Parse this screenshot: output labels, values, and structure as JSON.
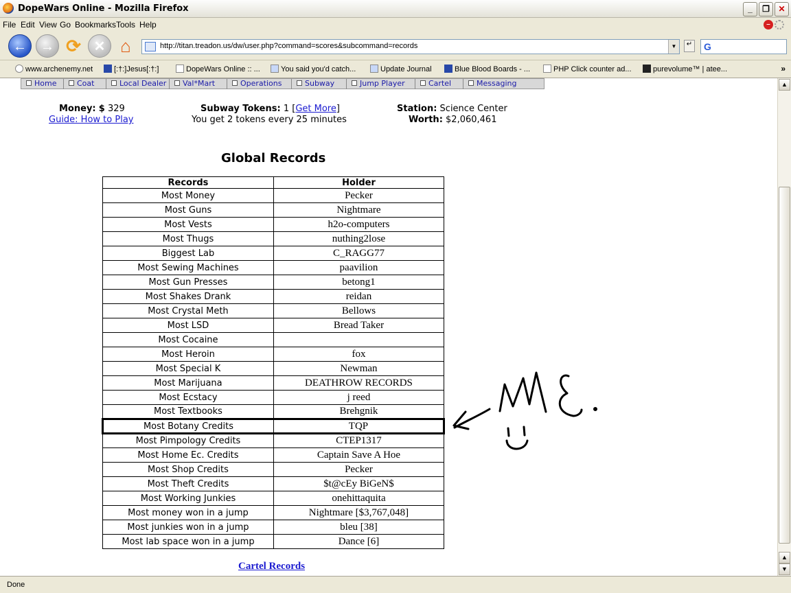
{
  "window": {
    "title": "DopeWars Online - Mozilla Firefox"
  },
  "menu": [
    "File",
    "Edit",
    "View",
    "Go",
    "Bookmarks",
    "Tools",
    "Help"
  ],
  "address": {
    "url": "http://titan.treadon.us/dw/user.php?command=scores&subcommand=records"
  },
  "search": {
    "engine_glyph": "G"
  },
  "bookmarks": [
    "www.archenemy.net",
    "[:†:]Jesus[:†:]",
    "DopeWars Online :: ...",
    "You said you'd catch...",
    "Update Journal",
    "Blue Blood Boards - ...",
    "PHP Click counter ad...",
    "purevolume™ | atee..."
  ],
  "bookmarks_more": "»",
  "game_nav": [
    "Home",
    "Coat",
    "Local Dealer",
    "Val*Mart",
    "Operations",
    "Subway",
    "Jump Player",
    "Cartel",
    "Messaging"
  ],
  "summary": {
    "money_label": "Money:",
    "money_currency": "$",
    "money_value": "329",
    "guide_link": "Guide: How to Play",
    "tokens_label": "Subway Tokens:",
    "tokens_value": "1",
    "get_more": "Get More",
    "tokens_note": "You get 2 tokens every 25 minutes",
    "station_label": "Station:",
    "station_value": "Science Center",
    "worth_label": "Worth:",
    "worth_value": "$2,060,461"
  },
  "records": {
    "title": "Global Records",
    "headers": [
      "Records",
      "Holder"
    ],
    "rows": [
      [
        "Most Money",
        "Pecker"
      ],
      [
        "Most Guns",
        "Nightmare"
      ],
      [
        "Most Vests",
        "h2o-computers"
      ],
      [
        "Most Thugs",
        "nuthing2lose"
      ],
      [
        "Biggest Lab",
        "C_RAGG77"
      ],
      [
        "Most Sewing Machines",
        "paavilion"
      ],
      [
        "Most Gun Presses",
        "betong1"
      ],
      [
        "Most Shakes Drank",
        "reidan"
      ],
      [
        "Most Crystal Meth",
        "Bellows"
      ],
      [
        "Most LSD",
        "Bread Taker"
      ],
      [
        "Most Cocaine",
        ""
      ],
      [
        "Most Heroin",
        "fox"
      ],
      [
        "Most Special K",
        "Newman"
      ],
      [
        "Most Marijuana",
        "DEATHROW RECORDS"
      ],
      [
        "Most Ecstacy",
        "j reed"
      ],
      [
        "Most Textbooks",
        "Brehgnik"
      ],
      [
        "Most Botany Credits",
        "TQP"
      ],
      [
        "Most Pimpology Credits",
        "CTEP1317"
      ],
      [
        "Most Home Ec. Credits",
        "Captain Save A Hoe"
      ],
      [
        "Most Shop Credits",
        "Pecker"
      ],
      [
        "Most Theft Credits",
        "$t@cEy BiGeN$"
      ],
      [
        "Most Working Junkies",
        "onehittaquita"
      ],
      [
        "Most money won in a jump",
        "Nightmare [$3,767,048]"
      ],
      [
        "Most junkies won in a jump",
        "bleu [38]"
      ],
      [
        "Most lab space won in a jump",
        "Dance [6]"
      ]
    ],
    "highlight_row": 16
  },
  "cartel_link": "Cartel Records",
  "annotation": {
    "text": "ME"
  },
  "status": {
    "text": "Done"
  }
}
